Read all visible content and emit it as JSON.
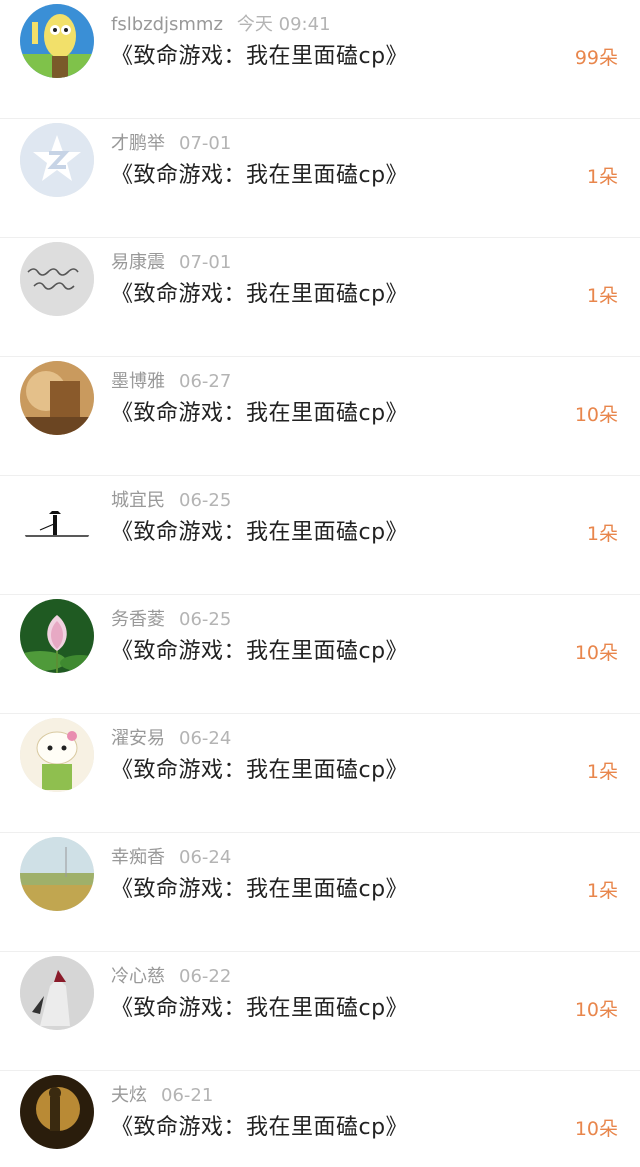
{
  "colors": {
    "accent": "#e8864c",
    "name": "#999999",
    "time": "#b4b4b4",
    "title": "#222222"
  },
  "rows": [
    {
      "name": "fslbzdjsmmz",
      "time": "今天 09:41",
      "title": "《致命游戏：我在里面磕cp》",
      "gift": "99朵",
      "avatar_icon": "cartoon-avatar-icon"
    },
    {
      "name": "才鹏举",
      "time": "07-01",
      "title": "《致命游戏：我在里面磕cp》",
      "gift": "1朵",
      "avatar_icon": "default-qzone-avatar-icon"
    },
    {
      "name": "易康震",
      "time": "07-01",
      "title": "《致命游戏：我在里面磕cp》",
      "gift": "1朵",
      "avatar_icon": "handwriting-avatar-icon"
    },
    {
      "name": "墨博雅",
      "time": "06-27",
      "title": "《致命游戏：我在里面磕cp》",
      "gift": "10朵",
      "avatar_icon": "warm-photo-avatar-icon"
    },
    {
      "name": "城宜民",
      "time": "06-25",
      "title": "《致命游戏：我在里面磕cp》",
      "gift": "1朵",
      "avatar_icon": "silhouette-avatar-icon"
    },
    {
      "name": "务香菱",
      "time": "06-25",
      "title": "《致命游戏：我在里面磕cp》",
      "gift": "10朵",
      "avatar_icon": "lotus-avatar-icon"
    },
    {
      "name": "濯安易",
      "time": "06-24",
      "title": "《致命游戏：我在里面磕cp》",
      "gift": "1朵",
      "avatar_icon": "kitty-avatar-icon"
    },
    {
      "name": "幸痴香",
      "time": "06-24",
      "title": "《致命游戏：我在里面磕cp》",
      "gift": "1朵",
      "avatar_icon": "field-avatar-icon"
    },
    {
      "name": "冷心慈",
      "time": "06-22",
      "title": "《致命游戏：我在里面磕cp》",
      "gift": "10朵",
      "avatar_icon": "figure-avatar-icon"
    },
    {
      "name": "夫炫",
      "time": "06-21",
      "title": "《致命游戏：我在里面磕cp》",
      "gift": "10朵",
      "avatar_icon": "dark-gold-avatar-icon"
    }
  ]
}
